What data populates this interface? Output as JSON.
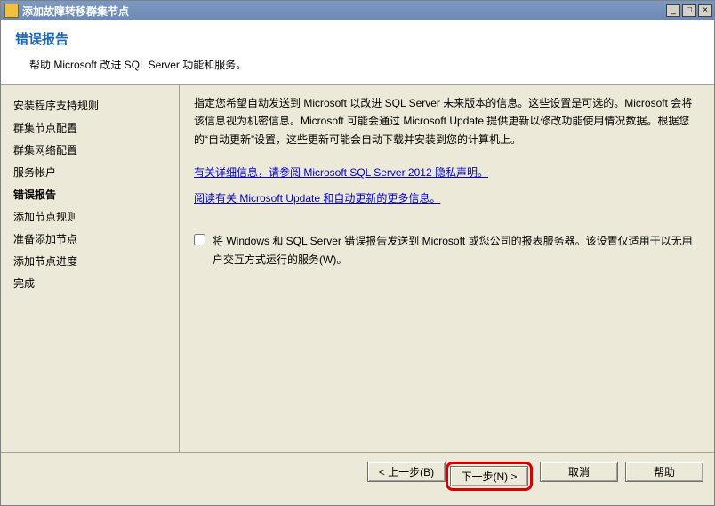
{
  "window": {
    "title": "添加故障转移群集节点"
  },
  "header": {
    "heading": "错误报告",
    "subtitle": "帮助 Microsoft 改进 SQL Server 功能和服务。"
  },
  "sidebar": {
    "items": [
      {
        "label": "安装程序支持规则"
      },
      {
        "label": "群集节点配置"
      },
      {
        "label": "群集网络配置"
      },
      {
        "label": "服务帐户"
      },
      {
        "label": "错误报告",
        "current": true
      },
      {
        "label": "添加节点规则"
      },
      {
        "label": "准备添加节点"
      },
      {
        "label": "添加节点进度"
      },
      {
        "label": "完成"
      }
    ]
  },
  "content": {
    "description": "指定您希望自动发送到 Microsoft 以改进 SQL Server 未来版本的信息。这些设置是可选的。Microsoft 会将该信息视为机密信息。Microsoft 可能会通过 Microsoft Update 提供更新以修改功能使用情况数据。根据您的“自动更新”设置，这些更新可能会自动下载并安装到您的计算机上。",
    "link_privacy": "有关详细信息，请参阅 Microsoft SQL Server 2012 隐私声明。",
    "link_update": "阅读有关 Microsoft Update 和自动更新的更多信息。",
    "checkbox_label": "将 Windows 和 SQL Server 错误报告发送到 Microsoft 或您公司的报表服务器。该设置仅适用于以无用户交互方式运行的服务(W)。"
  },
  "footer": {
    "back": "< 上一步(B)",
    "next": "下一步(N) >",
    "cancel": "取消",
    "help": "帮助"
  }
}
